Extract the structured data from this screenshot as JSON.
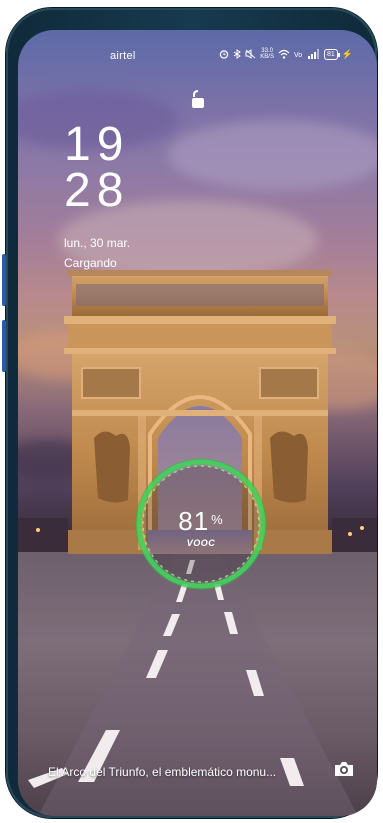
{
  "status_bar": {
    "carrier": "airtel",
    "network_speed": "33.0",
    "network_speed_unit": "KB/S",
    "battery_level": "81",
    "icons": [
      "alarm-icon",
      "bluetooth-icon",
      "mute-icon",
      "wifi-icon",
      "volte-icon",
      "signal-icon",
      "battery-icon",
      "charging-icon"
    ]
  },
  "lock_screen": {
    "hour": "19",
    "minute": "28",
    "date": "lun., 30 mar.",
    "charging_status": "Cargando"
  },
  "charging": {
    "percent": "81",
    "percent_unit": "%",
    "brand": "VOOC",
    "ring_color": "#43d15b"
  },
  "wallpaper": {
    "caption": "El Arco del Triunfo, el emblemático monu...",
    "camera_icon": "camera-icon"
  }
}
